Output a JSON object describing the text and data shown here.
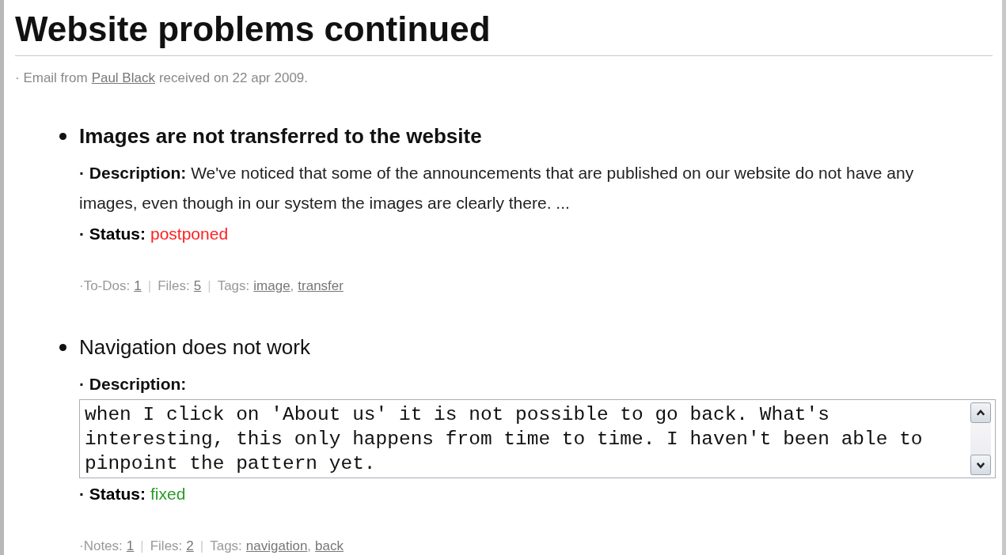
{
  "title": "Website problems continued",
  "source": [
    {
      "kind": "text",
      "text": "· Email from"
    },
    {
      "kind": "link",
      "text": "Paul Black"
    },
    {
      "kind": "text",
      "text": "received on 22 apr 2009."
    }
  ],
  "issues": [
    {
      "title": "Images are not transferred to the website",
      "description_label": "· Description:",
      "kind": "text",
      "description": "We've noticed that some of the announcements that are published on our website do not have any images, even though in our system the images are clearly there. ...",
      "status_label": "· Status:",
      "status": {
        "text": "postponed",
        "color": "#ff2020"
      },
      "meta": [
        {
          "kind": "text",
          "text": "·To-Dos:"
        },
        {
          "kind": "link",
          "text": "1"
        },
        {
          "kind": "sep",
          "text": "|"
        },
        {
          "kind": "text",
          "text": "Files:"
        },
        {
          "kind": "link",
          "text": "5"
        },
        {
          "kind": "sep",
          "text": "|"
        },
        {
          "kind": "text",
          "text": "Tags:"
        },
        {
          "kind": "link",
          "text": "image"
        },
        {
          "kind": "punct",
          "text": ","
        },
        {
          "kind": "link",
          "text": "transfer"
        }
      ]
    },
    {
      "title": "Navigation does not work",
      "description_label": "· Description:",
      "kind": "editor",
      "description": "when I click on 'About us' it is not possible to go back. What's interesting, this only happens from time to time. I haven't been able to pinpoint the pattern yet.",
      "status_label": "· Status:",
      "status": {
        "text": "fixed",
        "color": "#2a9a2a"
      },
      "meta": [
        {
          "kind": "text",
          "text": "·Notes:"
        },
        {
          "kind": "link",
          "text": "1"
        },
        {
          "kind": "sep",
          "text": "|"
        },
        {
          "kind": "text",
          "text": "Files:"
        },
        {
          "kind": "link",
          "text": "2"
        },
        {
          "kind": "sep",
          "text": "|"
        },
        {
          "kind": "text",
          "text": "Tags:"
        },
        {
          "kind": "link",
          "text": "navigation"
        },
        {
          "kind": "punct",
          "text": ","
        },
        {
          "kind": "link",
          "text": "back"
        }
      ]
    }
  ]
}
